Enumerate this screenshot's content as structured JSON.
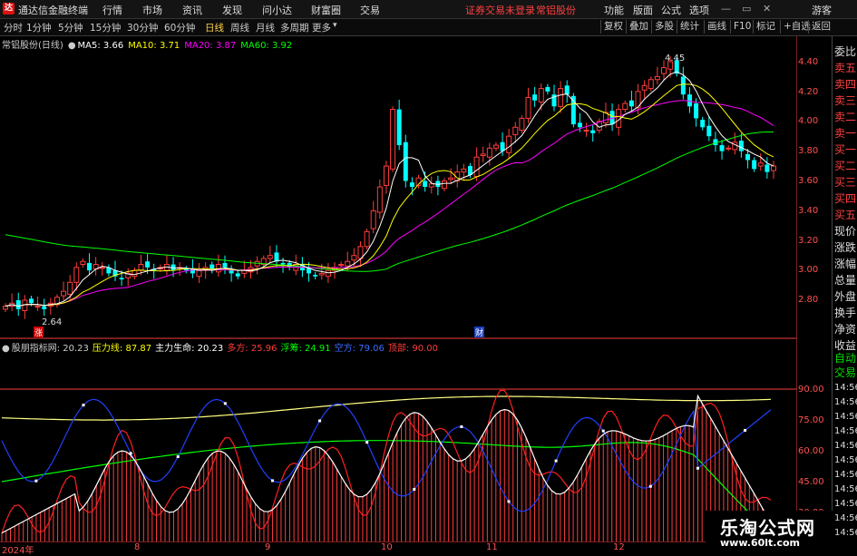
{
  "titlebar": {
    "app_name": "通达信金融终端",
    "menus": [
      "行情",
      "市场",
      "资讯",
      "发现",
      "问小达",
      "财富圈",
      "交易"
    ],
    "notice": "证券交易未登录",
    "stock_name": "常铝股份",
    "right_menus": [
      "功能",
      "版面",
      "公式",
      "选项"
    ],
    "user": "游客"
  },
  "toolbar": {
    "periods": [
      "分时",
      "1分钟",
      "5分钟",
      "15分钟",
      "30分钟",
      "60分钟",
      "日线",
      "周线",
      "月线",
      "多周期",
      "更多"
    ],
    "active_period": "日线",
    "right_buttons": [
      "复权",
      "叠加",
      "多股",
      "统计",
      "画线",
      "F10",
      "标记",
      "+自选",
      "返回"
    ]
  },
  "main_legend": {
    "title": "常铝股份(日线)",
    "ma5": "MA5: 3.66",
    "ma10": "MA10: 3.71",
    "ma20": "MA20: 3.87",
    "ma60": "MA60: 3.92"
  },
  "price_axis": [
    "4.40",
    "4.20",
    "4.00",
    "3.80",
    "3.60",
    "3.40",
    "3.20",
    "3.00",
    "2.80"
  ],
  "annotations": {
    "high": "4.45",
    "low": "2.64",
    "zhang": "涨",
    "cai": "财"
  },
  "indicator_legend": {
    "name": "股朋指标网",
    "value": ": 20.23",
    "pressure": "压力线: 87.87",
    "main_life": "主力生命: 20.23",
    "duofang": "多方: 25.96",
    "fuchou": "浮筹: 24.91",
    "kongfang": "空方: 79.06",
    "dingbu": "顶部: 90.00"
  },
  "indicator_axis": [
    "90.00",
    "75.00",
    "60.00",
    "45.00",
    "30.00"
  ],
  "x_axis": [
    "2024年",
    "8",
    "9",
    "10",
    "11",
    "12"
  ],
  "right_panel": [
    "委比",
    "卖五",
    "卖四",
    "卖三",
    "卖二",
    "卖一",
    "买一",
    "买二",
    "买三",
    "买四",
    "买五",
    "现价",
    "涨跌",
    "涨幅",
    "总量",
    "外盘",
    "换手",
    "净资",
    "收益",
    "自动",
    "交易",
    "14:56",
    "14:56",
    "14:56",
    "14:56",
    "14:56",
    "14:56",
    "14:56",
    "14:56",
    "14:56",
    "14:56",
    "14:56"
  ],
  "watermark": {
    "line1": "乐淘公式网",
    "line2": "www.60lt.com"
  },
  "colors": {
    "up": "#ff3c3c",
    "down": "#00ffff",
    "ma5": "#ffffff",
    "ma10": "#ffff00",
    "ma20": "#ff00ff",
    "ma60": "#00ff00",
    "axis": "#ff5050"
  },
  "chart_data": {
    "type": "candlestick",
    "ylim": [
      2.6,
      4.5
    ],
    "closes": [
      2.76,
      2.78,
      2.74,
      2.8,
      2.78,
      2.76,
      2.74,
      2.78,
      2.82,
      2.86,
      2.92,
      3.02,
      3.06,
      3.0,
      3.04,
      3.02,
      2.98,
      2.96,
      2.94,
      2.98,
      3.0,
      3.04,
      3.02,
      3.0,
      3.02,
      3.04,
      3.0,
      3.02,
      3.0,
      2.98,
      3.0,
      3.02,
      3.0,
      3.04,
      3.02,
      2.98,
      2.96,
      3.0,
      3.02,
      3.06,
      3.08,
      3.1,
      3.06,
      3.04,
      3.02,
      3.04,
      3.0,
      2.98,
      2.96,
      2.98,
      3.0,
      3.02,
      3.04,
      3.06,
      3.1,
      3.16,
      3.26,
      3.4,
      3.56,
      3.7,
      4.08,
      3.84,
      3.6,
      3.56,
      3.62,
      3.56,
      3.58,
      3.56,
      3.6,
      3.62,
      3.66,
      3.68,
      3.64,
      3.76,
      3.78,
      3.82,
      3.84,
      3.8,
      3.9,
      3.96,
      4.02,
      4.16,
      4.14,
      4.22,
      4.2,
      4.1,
      4.22,
      4.18,
      3.98,
      3.96,
      3.94,
      3.92,
      4.0,
      4.06,
      3.98,
      4.08,
      4.12,
      4.1,
      4.2,
      4.24,
      4.28,
      4.3,
      4.36,
      4.4,
      4.32,
      4.18,
      4.1,
      4.02,
      3.96,
      3.9,
      3.84,
      3.8,
      3.82,
      3.86,
      3.8,
      3.74,
      3.68,
      3.72,
      3.66,
      3.7
    ],
    "ma60_start": 3.24,
    "indicator_ylim": [
      15,
      95
    ],
    "duofang_value": 25.96,
    "fuchou_value": 24.91,
    "kongfang_value": 79.06,
    "dingbu_value": 90.0,
    "pressure_value": 87.87
  }
}
